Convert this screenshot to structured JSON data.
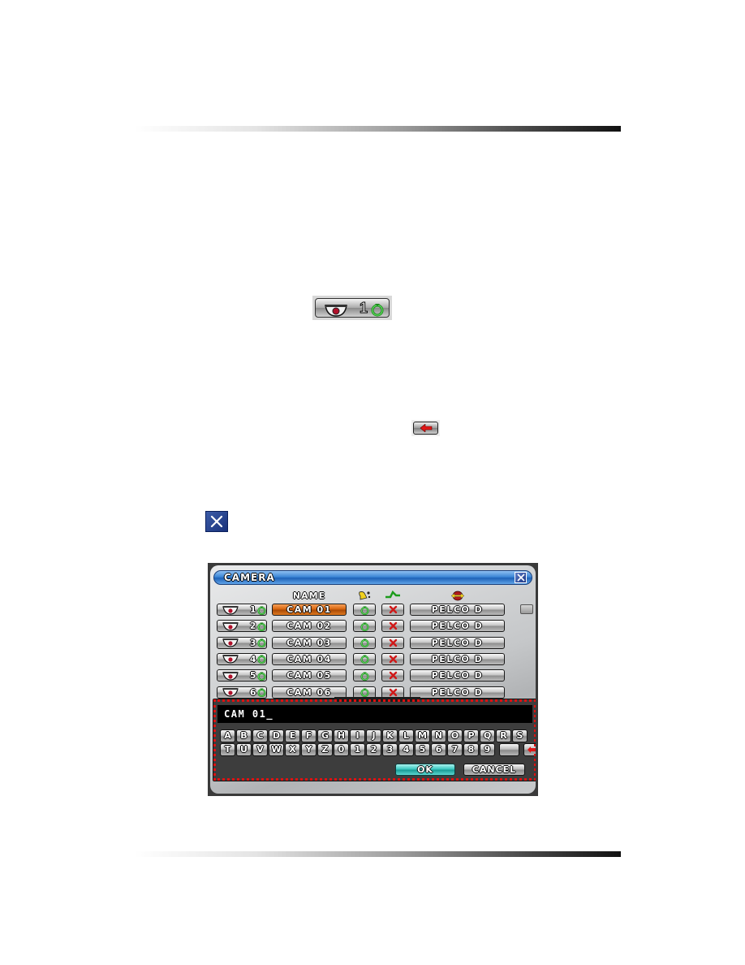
{
  "icons": {
    "camera_button_sample": {
      "number": "1",
      "icons": [
        "camera-dome-icon",
        "recording-icon"
      ]
    },
    "backspace_sample": {
      "icon": "backspace-arrow-icon"
    },
    "close_sample": {
      "icon": "close-x-icon"
    }
  },
  "dialog": {
    "title": "CAMERA",
    "close_icon": "close-x-icon",
    "columns": {
      "name": "NAME",
      "alarm_icon": "bell-icon",
      "motion_icon": "motion-icon",
      "ptz_icon": "ptz-arrows-icon"
    },
    "rows": [
      {
        "camera": "1",
        "name": "CAM 01",
        "alarm": "on",
        "motion": "off",
        "ptz": "PELCO D",
        "selected": true
      },
      {
        "camera": "2",
        "name": "CAM 02",
        "alarm": "on",
        "motion": "off",
        "ptz": "PELCO D",
        "selected": false
      },
      {
        "camera": "3",
        "name": "CAM 03",
        "alarm": "on",
        "motion": "off",
        "ptz": "PELCO D",
        "selected": false
      },
      {
        "camera": "4",
        "name": "CAM 04",
        "alarm": "on",
        "motion": "off",
        "ptz": "PELCO D",
        "selected": false
      },
      {
        "camera": "5",
        "name": "CAM 05",
        "alarm": "on",
        "motion": "off",
        "ptz": "PELCO D",
        "selected": false
      },
      {
        "camera": "6",
        "name": "CAM 06",
        "alarm": "on",
        "motion": "off",
        "ptz": "PELCO D",
        "selected": false
      }
    ],
    "keyboard": {
      "input_value": "CAM 01_",
      "row1": [
        "A",
        "B",
        "C",
        "D",
        "E",
        "F",
        "G",
        "H",
        "I",
        "J",
        "K",
        "L",
        "M",
        "N",
        "O",
        "P",
        "Q",
        "R",
        "S"
      ],
      "row2": [
        "T",
        "U",
        "V",
        "W",
        "X",
        "Y",
        "Z",
        "0",
        "1",
        "2",
        "3",
        "4",
        "5",
        "6",
        "7",
        "8",
        "9"
      ],
      "space_key": "",
      "backspace_icon": "backspace-arrow-icon",
      "ok_label": "OK",
      "cancel_label": "CANCEL"
    }
  },
  "colors": {
    "selected_row": "#d8650f",
    "title_bar": "#3c86d6",
    "ok_button": "#3cc8c1",
    "highlight_outline": "#e01010",
    "record_green": "#2fae2f",
    "motion_off_red": "#d01818"
  }
}
